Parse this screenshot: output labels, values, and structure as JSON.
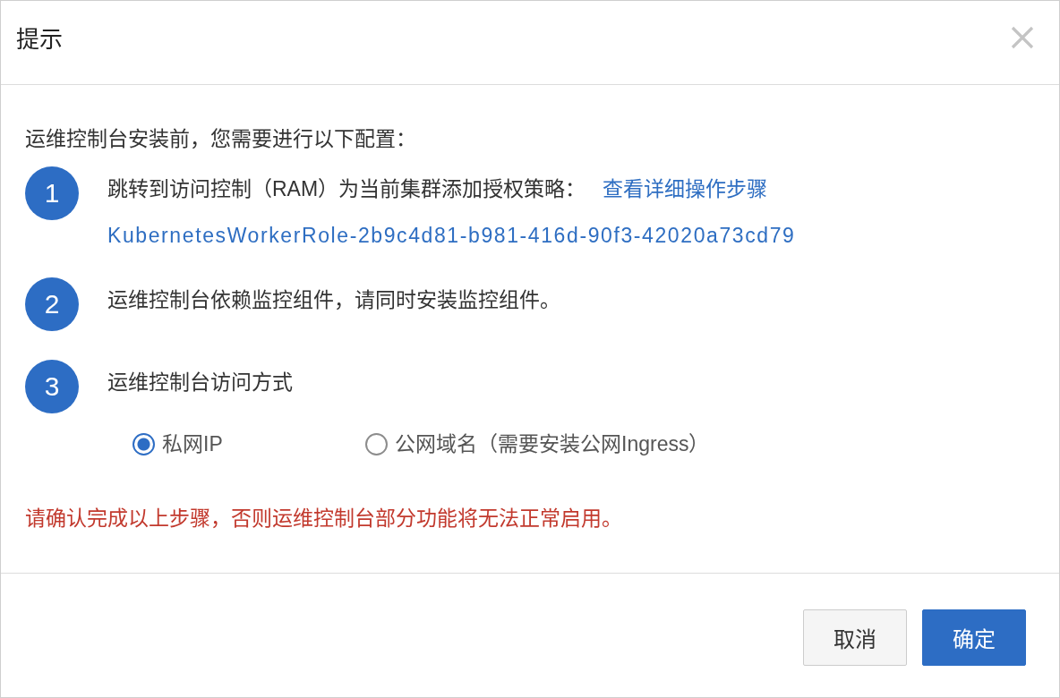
{
  "dialog": {
    "title": "提示"
  },
  "intro": "运维控制台安装前，您需要进行以下配置：",
  "steps": [
    {
      "number": "1",
      "text": "跳转到访问控制（RAM）为当前集群添加授权策略：",
      "link": "查看详细操作步骤",
      "detail_link": "KubernetesWorkerRole-2b9c4d81-b981-416d-90f3-42020a73cd79"
    },
    {
      "number": "2",
      "text": "运维控制台依赖监控组件，请同时安装监控组件。"
    },
    {
      "number": "3",
      "text": "运维控制台访问方式",
      "options": [
        {
          "label": "私网IP",
          "selected": true
        },
        {
          "label": "公网域名（需要安装公网Ingress）",
          "selected": false
        }
      ]
    }
  ],
  "warning": "请确认完成以上步骤，否则运维控制台部分功能将无法正常启用。",
  "buttons": [
    {
      "label": "取消",
      "kind": "secondary"
    },
    {
      "label": "确定",
      "kind": "primary"
    }
  ]
}
